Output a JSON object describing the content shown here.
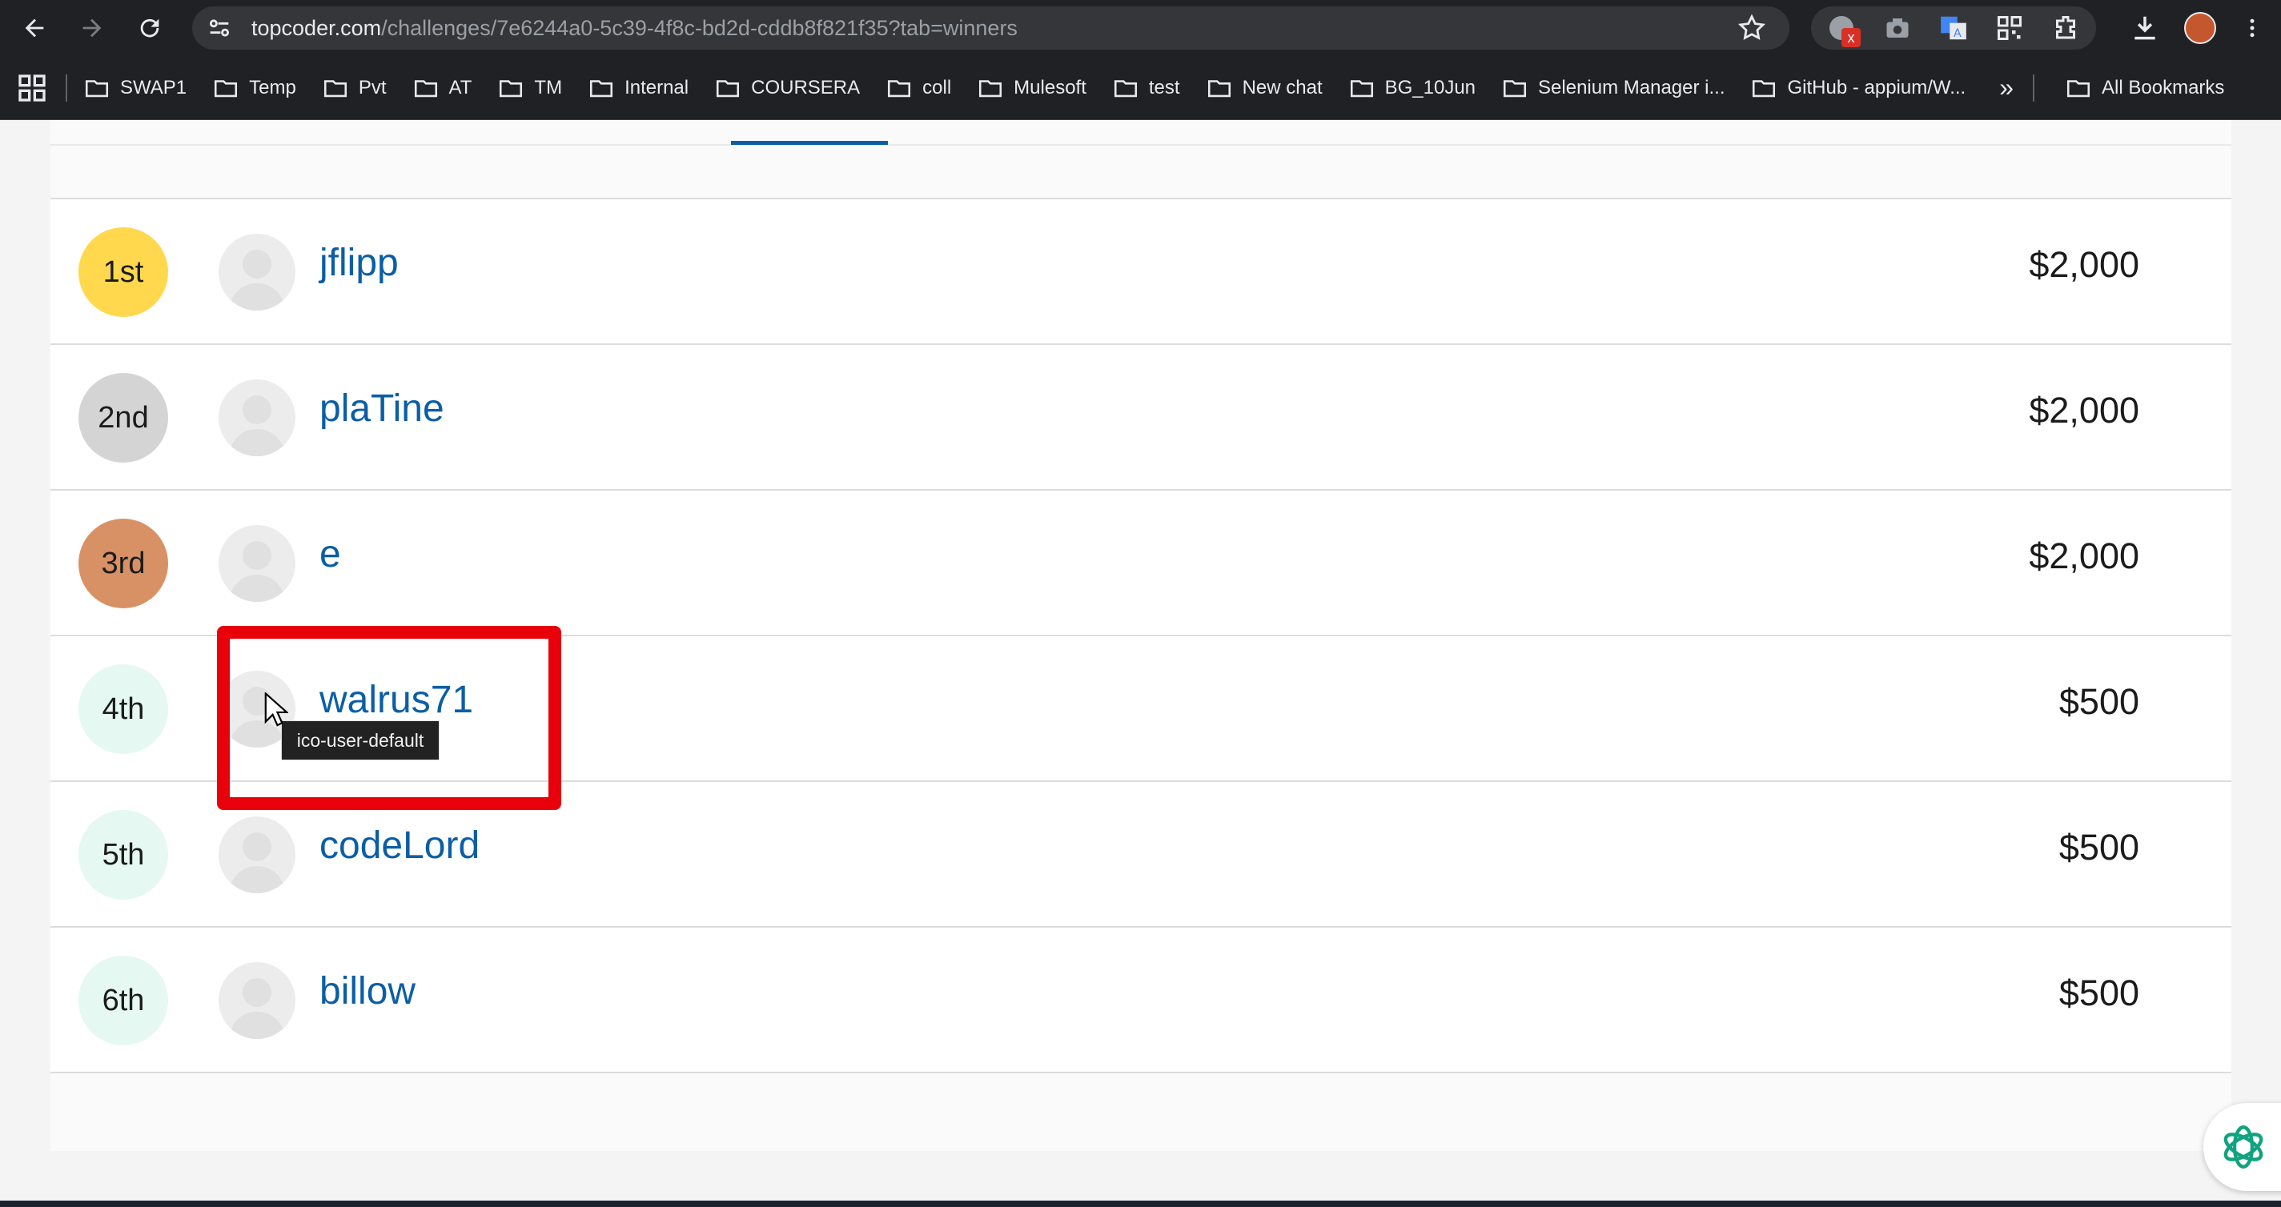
{
  "browser": {
    "url_domain": "topcoder.com",
    "url_path": "/challenges/7e6244a0-5c39-4f8c-bd2d-cddb8f821f35?tab=winners",
    "extension_badge": "x"
  },
  "bookmarks": [
    {
      "label": "SWAP1"
    },
    {
      "label": "Temp"
    },
    {
      "label": "Pvt"
    },
    {
      "label": "AT"
    },
    {
      "label": "TM"
    },
    {
      "label": "Internal"
    },
    {
      "label": "COURSERA"
    },
    {
      "label": "coll"
    },
    {
      "label": "Mulesoft"
    },
    {
      "label": "test"
    },
    {
      "label": "New chat"
    },
    {
      "label": "BG_10Jun"
    },
    {
      "label": "Selenium Manager i..."
    },
    {
      "label": "GitHub - appium/W..."
    }
  ],
  "bookmarks_more": "»",
  "all_bookmarks": "All Bookmarks",
  "winners": [
    {
      "place": "1st",
      "handle": "jflipp",
      "prize": "$2,000",
      "badge_color": "#ffd84d"
    },
    {
      "place": "2nd",
      "handle": "plaTine",
      "prize": "$2,000",
      "badge_color": "#d4d4d4"
    },
    {
      "place": "3rd",
      "handle": "e",
      "prize": "$2,000",
      "badge_color": "#d89165"
    },
    {
      "place": "4th",
      "handle": "walrus71",
      "prize": "$500",
      "badge_color": "#e5f8f2"
    },
    {
      "place": "5th",
      "handle": "codeLord",
      "prize": "$500",
      "badge_color": "#e5f8f2"
    },
    {
      "place": "6th",
      "handle": "billow",
      "prize": "$500",
      "badge_color": "#e5f8f2"
    }
  ],
  "tooltip": "ico-user-default",
  "colors": {
    "link": "#0b5ea6",
    "highlight": "#e8000b"
  }
}
